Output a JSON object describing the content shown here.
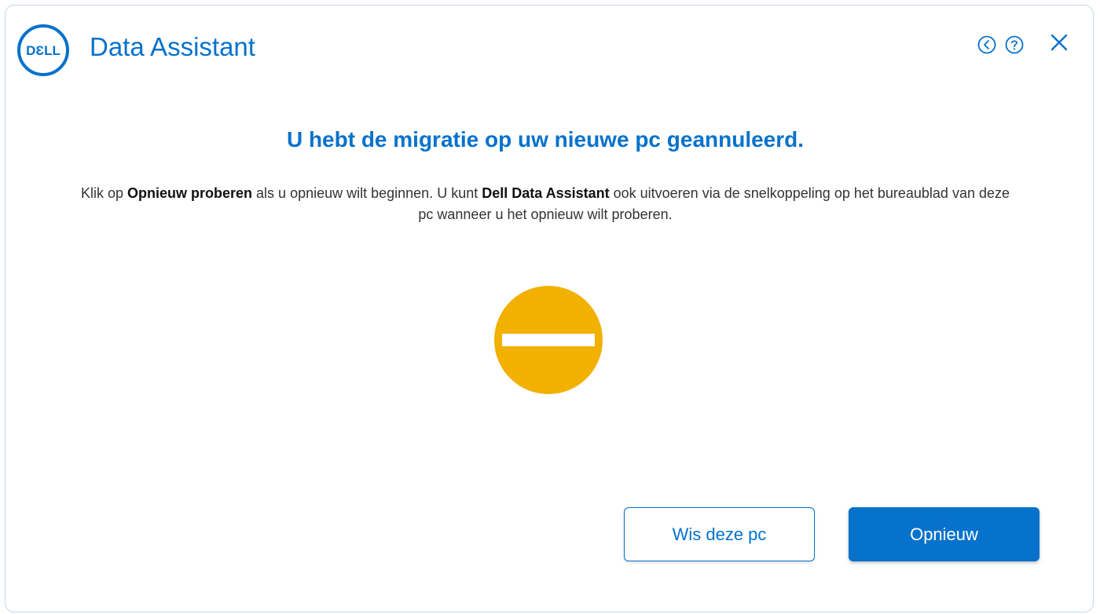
{
  "header": {
    "logo_text": "DƐLL",
    "title": "Data Assistant",
    "back_icon": "back-circle-icon",
    "help_icon": "help-circle-icon",
    "close_icon": "close-icon"
  },
  "main": {
    "heading": "U hebt de migratie op uw nieuwe pc geannuleerd.",
    "description": {
      "part1": "Klik op ",
      "bold1": "Opnieuw proberen",
      "part2": " als u opnieuw wilt beginnen. U kunt ",
      "bold2": "Dell Data Assistant",
      "part3": " ook uitvoeren via de snelkoppeling op het bureaublad van deze pc wanneer u het opnieuw wilt proberen."
    },
    "status_icon": "cancel-minus-icon"
  },
  "buttons": {
    "secondary_label": "Wis deze pc",
    "primary_label": "Opnieuw"
  },
  "colors": {
    "brand_blue": "#0672cb",
    "status_yellow": "#f2b000",
    "text": "#333333"
  }
}
